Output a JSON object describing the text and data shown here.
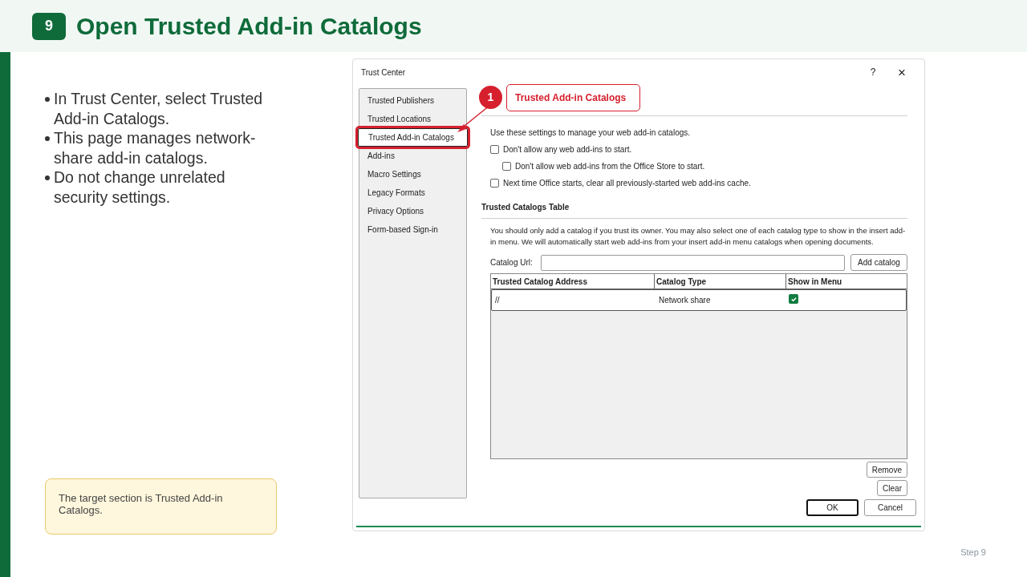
{
  "header": {
    "step": "9",
    "title": "Open Trusted Add-in Catalogs"
  },
  "bullets": [
    "In Trust Center, select Trusted Add-in Catalogs.",
    "This page manages network-share add-in catalogs.",
    "Do not change unrelated security settings."
  ],
  "note": "The target section is Trusted Add-in Catalogs.",
  "dialog": {
    "title": "Trust Center",
    "help": "?",
    "close": "×",
    "sidebar": [
      {
        "label": "Trusted Publishers",
        "selected": false
      },
      {
        "label": "Trusted Locations",
        "selected": false
      },
      {
        "label": "Trusted Add-in Catalogs",
        "selected": true
      },
      {
        "label": "Add-ins",
        "selected": false
      },
      {
        "label": "Macro Settings",
        "selected": false
      },
      {
        "label": "Legacy Formats",
        "selected": false
      },
      {
        "label": "Privacy Options",
        "selected": false
      },
      {
        "label": "Form-based Sign-in",
        "selected": false
      }
    ],
    "callout": {
      "number": "1",
      "label": "Trusted Add-in Catalogs"
    },
    "intro": "Use these settings to manage your web add-in catalogs.",
    "options": [
      {
        "label": "Don't allow any web add-ins to start.",
        "checked": false,
        "indented": false
      },
      {
        "label": "Don't allow web add-ins from the Office Store to start.",
        "checked": false,
        "indented": true
      },
      {
        "label": "Next time Office starts, clear all previously-started web add-ins cache.",
        "checked": false,
        "indented": false
      }
    ],
    "section_title": "Trusted Catalogs Table",
    "description": "You should only add a catalog if you trust its owner. You may also select one of each catalog type to show in the insert add-in menu. We will automatically start web add-ins from your insert add-in menu catalogs when opening documents.",
    "catalog_url": {
      "label": "Catalog Url:"
    },
    "add_button": {
      "label": "Add catalog"
    },
    "table": {
      "columns": [
        "Trusted Catalog Address",
        "Catalog Type",
        "Show in Menu"
      ],
      "rows": [
        {
          "address": "//",
          "type": "Network share",
          "show_in_menu": true
        }
      ]
    },
    "side_buttons": [
      {
        "label": "Remove"
      },
      {
        "label": "Clear"
      }
    ],
    "footer_buttons": [
      {
        "label": "OK",
        "default": true
      },
      {
        "label": "Cancel",
        "default": false
      }
    ]
  },
  "footer": "Step 9"
}
